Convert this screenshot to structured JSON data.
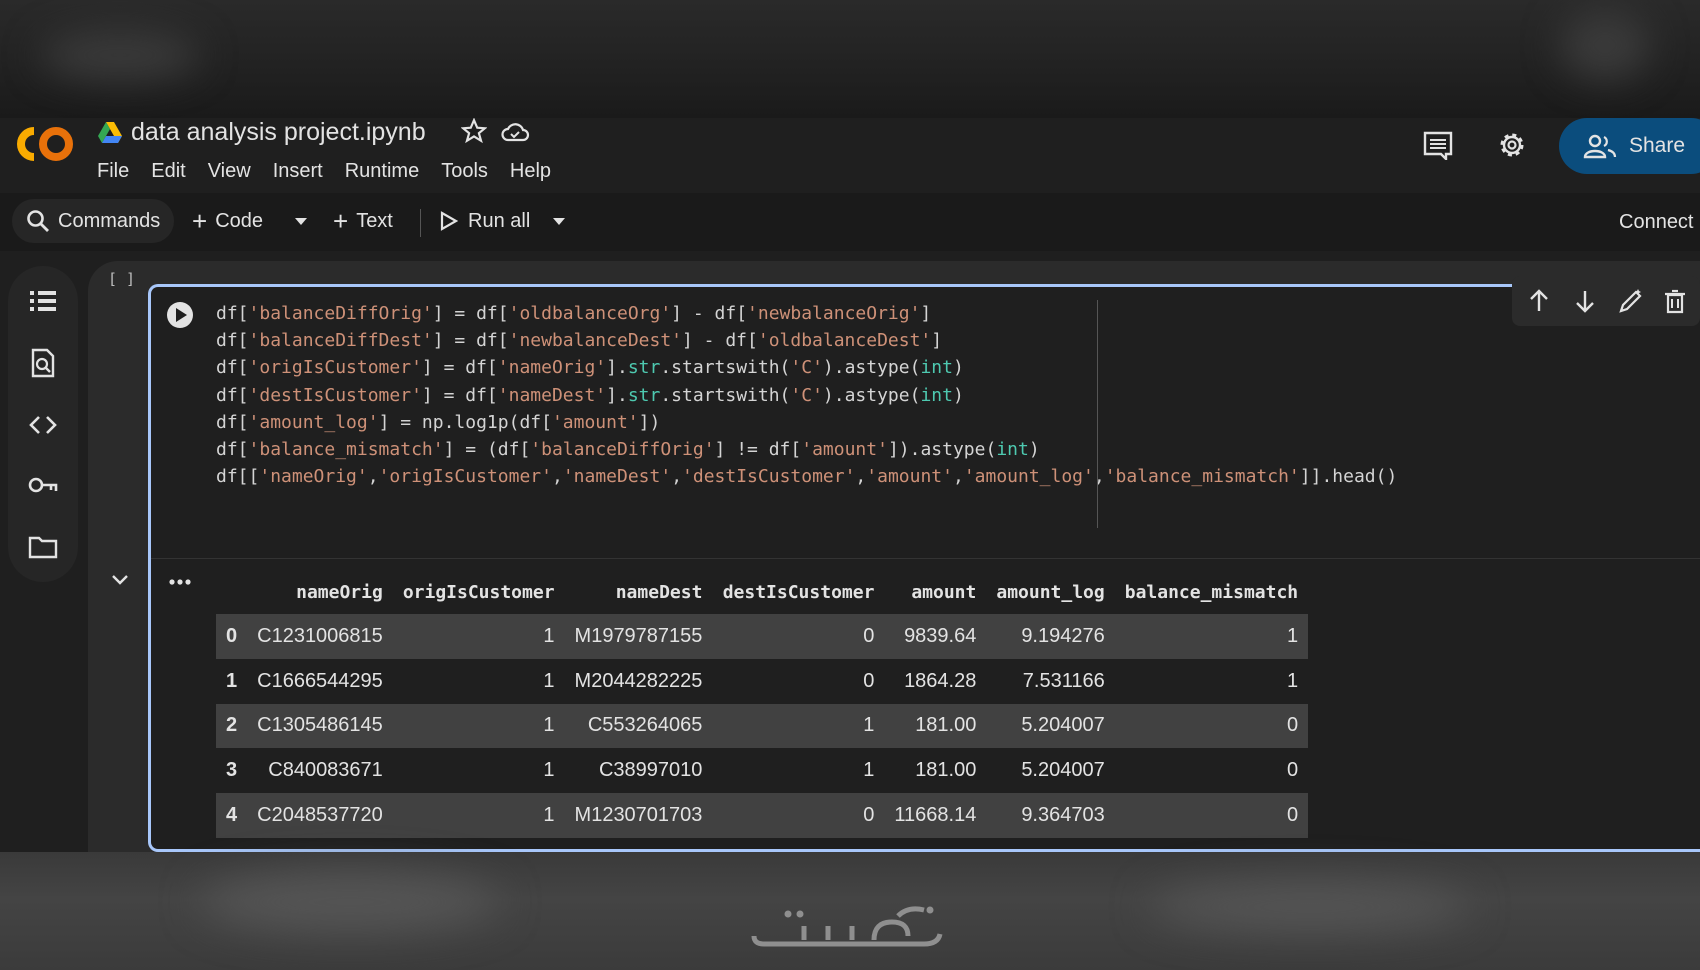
{
  "app": {
    "title": "data analysis project.ipynb",
    "menu": [
      "File",
      "Edit",
      "View",
      "Insert",
      "Runtime",
      "Tools",
      "Help"
    ],
    "share_label": "Share"
  },
  "toolbar": {
    "commands_label": "Commands",
    "code_label": "Code",
    "text_label": "Text",
    "run_all_label": "Run all",
    "connect_label": "Connect"
  },
  "cell": {
    "exec_count": "[ ]",
    "code": [
      [
        [
          "df[",
          "plain"
        ],
        [
          "'balanceDiffOrig'",
          "str"
        ],
        [
          "] = df[",
          "plain"
        ],
        [
          "'oldbalanceOrg'",
          "str"
        ],
        [
          "] - df[",
          "plain"
        ],
        [
          "'newbalanceOrig'",
          "str"
        ],
        [
          "]",
          "plain"
        ]
      ],
      [
        [
          "df[",
          "plain"
        ],
        [
          "'balanceDiffDest'",
          "str"
        ],
        [
          "] = df[",
          "plain"
        ],
        [
          "'newbalanceDest'",
          "str"
        ],
        [
          "] - df[",
          "plain"
        ],
        [
          "'oldbalanceDest'",
          "str"
        ],
        [
          "]",
          "plain"
        ]
      ],
      [
        [
          "df[",
          "plain"
        ],
        [
          "'origIsCustomer'",
          "str"
        ],
        [
          "] = df[",
          "plain"
        ],
        [
          "'nameOrig'",
          "str"
        ],
        [
          "].",
          "plain"
        ],
        [
          "str",
          "fn"
        ],
        [
          ".startswith(",
          "plain"
        ],
        [
          "'C'",
          "str"
        ],
        [
          ").astype(",
          "plain"
        ],
        [
          "int",
          "fn"
        ],
        [
          ")",
          "plain"
        ]
      ],
      [
        [
          "df[",
          "plain"
        ],
        [
          "'destIsCustomer'",
          "str"
        ],
        [
          "] = df[",
          "plain"
        ],
        [
          "'nameDest'",
          "str"
        ],
        [
          "].",
          "plain"
        ],
        [
          "str",
          "fn"
        ],
        [
          ".startswith(",
          "plain"
        ],
        [
          "'C'",
          "str"
        ],
        [
          ").astype(",
          "plain"
        ],
        [
          "int",
          "fn"
        ],
        [
          ")",
          "plain"
        ]
      ],
      [
        [
          "df[",
          "plain"
        ],
        [
          "'amount_log'",
          "str"
        ],
        [
          "] = np.log1p(df[",
          "plain"
        ],
        [
          "'amount'",
          "str"
        ],
        [
          "])",
          "plain"
        ]
      ],
      [
        [
          "df[",
          "plain"
        ],
        [
          "'balance_mismatch'",
          "str"
        ],
        [
          "] = (df[",
          "plain"
        ],
        [
          "'balanceDiffOrig'",
          "str"
        ],
        [
          "] != df[",
          "plain"
        ],
        [
          "'amount'",
          "str"
        ],
        [
          "]).astype(",
          "plain"
        ],
        [
          "int",
          "fn"
        ],
        [
          ")",
          "plain"
        ]
      ],
      [
        [
          "df[[",
          "plain"
        ],
        [
          "'nameOrig'",
          "str"
        ],
        [
          ",",
          "plain"
        ],
        [
          "'origIsCustomer'",
          "str"
        ],
        [
          ",",
          "plain"
        ],
        [
          "'nameDest'",
          "str"
        ],
        [
          ",",
          "plain"
        ],
        [
          "'destIsCustomer'",
          "str"
        ],
        [
          ",",
          "plain"
        ],
        [
          "'amount'",
          "str"
        ],
        [
          ",",
          "plain"
        ],
        [
          "'amount_log'",
          "str"
        ],
        [
          ",",
          "plain"
        ],
        [
          "'balance_mismatch'",
          "str"
        ],
        [
          "]].head()",
          "plain"
        ]
      ]
    ]
  },
  "output": {
    "columns": [
      "",
      "nameOrig",
      "origIsCustomer",
      "nameDest",
      "destIsCustomer",
      "amount",
      "amount_log",
      "balance_mismatch"
    ],
    "rows": [
      [
        "0",
        "C1231006815",
        "1",
        "M1979787155",
        "0",
        "9839.64",
        "9.194276",
        "1"
      ],
      [
        "1",
        "C1666544295",
        "1",
        "M2044282225",
        "0",
        "1864.28",
        "7.531166",
        "1"
      ],
      [
        "2",
        "C1305486145",
        "1",
        "C553264065",
        "1",
        "181.00",
        "5.204007",
        "0"
      ],
      [
        "3",
        "C840083671",
        "1",
        "C38997010",
        "1",
        "181.00",
        "5.204007",
        "0"
      ],
      [
        "4",
        "C2048537720",
        "1",
        "M1230701703",
        "0",
        "11668.14",
        "9.364703",
        "0"
      ]
    ]
  },
  "watermark": "خمسات",
  "colors": {
    "string": "#ce9178",
    "function": "#4ec9b0",
    "plain": "#d4d4d4",
    "accent_border": "#a8c7fa",
    "share_bg": "#0b4d7d"
  }
}
